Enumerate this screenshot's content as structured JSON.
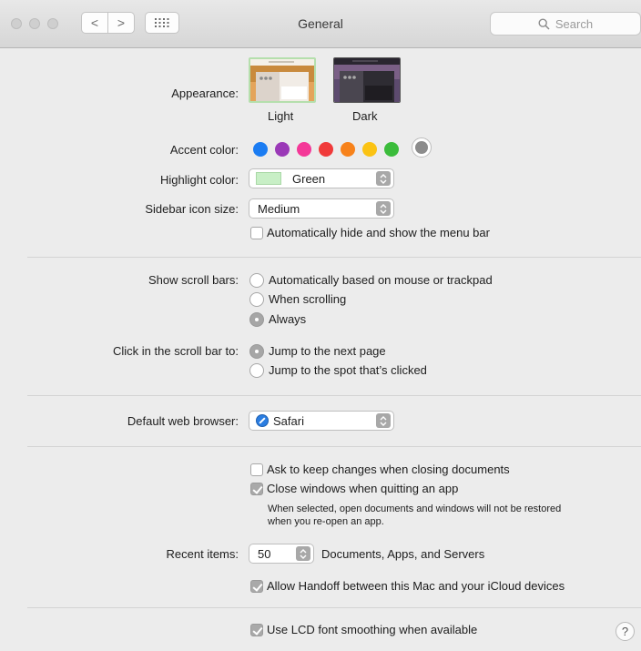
{
  "window": {
    "title": "General"
  },
  "toolbar": {
    "back_icon": "<",
    "forward_icon": ">",
    "search_placeholder": "Search"
  },
  "appearance": {
    "label": "Appearance:",
    "options": [
      {
        "label": "Light",
        "selected": true
      },
      {
        "label": "Dark",
        "selected": false
      }
    ]
  },
  "accent": {
    "label": "Accent color:",
    "colors": [
      "#1b7cf2",
      "#9a39b7",
      "#f43898",
      "#f03a3a",
      "#f7821b",
      "#fbc314",
      "#3bbc3b",
      "#8c8c8c"
    ],
    "selected_index": 7
  },
  "highlight": {
    "label": "Highlight color:",
    "value": "Green",
    "swatch": "#c8efc6"
  },
  "sidebar_icon_size": {
    "label": "Sidebar icon size:",
    "value": "Medium"
  },
  "menu_bar": {
    "label": "Automatically hide and show the menu bar",
    "checked": false
  },
  "scroll_bars": {
    "label": "Show scroll bars:",
    "options": [
      {
        "label": "Automatically based on mouse or trackpad",
        "selected": false
      },
      {
        "label": "When scrolling",
        "selected": false
      },
      {
        "label": "Always",
        "selected": true
      }
    ]
  },
  "click_scroll": {
    "label": "Click in the scroll bar to:",
    "options": [
      {
        "label": "Jump to the next page",
        "selected": true
      },
      {
        "label": "Jump to the spot that’s clicked",
        "selected": false
      }
    ]
  },
  "browser": {
    "label": "Default web browser:",
    "value": "Safari"
  },
  "documents": {
    "ask_keep": {
      "label": "Ask to keep changes when closing documents",
      "checked": false
    },
    "close_windows": {
      "label": "Close windows when quitting an app",
      "checked": true
    },
    "note_line1": "When selected, open documents and windows will not be restored",
    "note_line2": "when you re-open an app."
  },
  "recent": {
    "label": "Recent items:",
    "value": "50",
    "suffix": "Documents, Apps, and Servers"
  },
  "handoff": {
    "label": "Allow Handoff between this Mac and your iCloud devices",
    "checked": true
  },
  "lcd": {
    "label": "Use LCD font smoothing when available",
    "checked": true
  },
  "help": {
    "label": "?"
  }
}
